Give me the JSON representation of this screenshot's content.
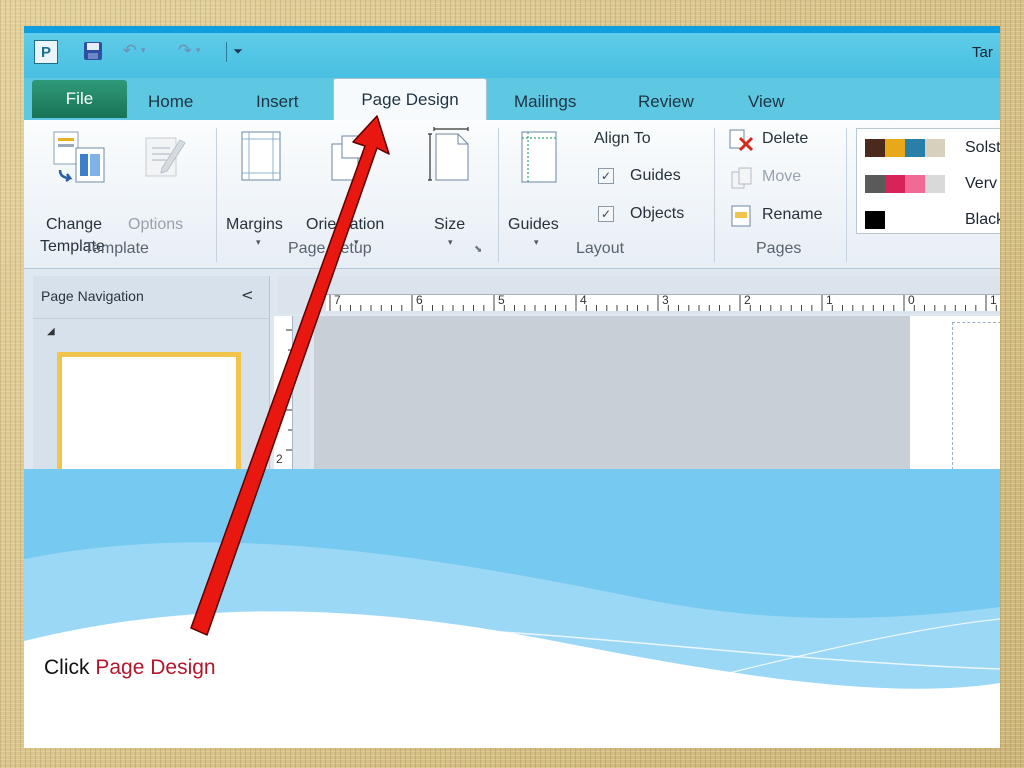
{
  "window": {
    "app_icon_letter": "P",
    "title": "Tar"
  },
  "tabs": [
    {
      "label": "File"
    },
    {
      "label": "Home"
    },
    {
      "label": "Insert"
    },
    {
      "label": "Page Design"
    },
    {
      "label": "Mailings"
    },
    {
      "label": "Review"
    },
    {
      "label": "View"
    }
  ],
  "ribbon": {
    "template": {
      "change_line1": "Change",
      "change_line2": "Template",
      "options": "Options",
      "group": "Template"
    },
    "page_setup": {
      "margins": "Margins",
      "orientation": "Orientation",
      "size": "Size",
      "group": "Page Setup"
    },
    "layout": {
      "guides": "Guides",
      "align_to": "Align To",
      "chk_guides": "Guides",
      "chk_objects": "Objects",
      "group": "Layout"
    },
    "pages": {
      "delete": "Delete",
      "move": "Move",
      "rename": "Rename",
      "group": "Pages"
    },
    "schemes": [
      {
        "name": "Solst",
        "colors": [
          "#4a2a1c",
          "#e8a81a",
          "#2a7fa8",
          "#d7d0bc"
        ]
      },
      {
        "name": "Verv",
        "colors": [
          "#5a5a5a",
          "#d6245a",
          "#f06a95",
          "#d9d9d9"
        ]
      },
      {
        "name": "Black",
        "colors": [
          "#000000"
        ]
      }
    ]
  },
  "nav": {
    "title": "Page Navigation",
    "collapse": "<"
  },
  "ruler": {
    "h_numbers": [
      "7",
      "6",
      "5",
      "4",
      "3",
      "2",
      "1",
      "0",
      "1"
    ],
    "v_number": "2"
  },
  "caption": {
    "prefix": "Click ",
    "highlight": "Page Design"
  },
  "colors": {
    "accent_red": "#e8170f",
    "caption_highlight": "#b2182b",
    "file_tab": "#2a8a6c",
    "sky_blue": "#76c9f1"
  }
}
